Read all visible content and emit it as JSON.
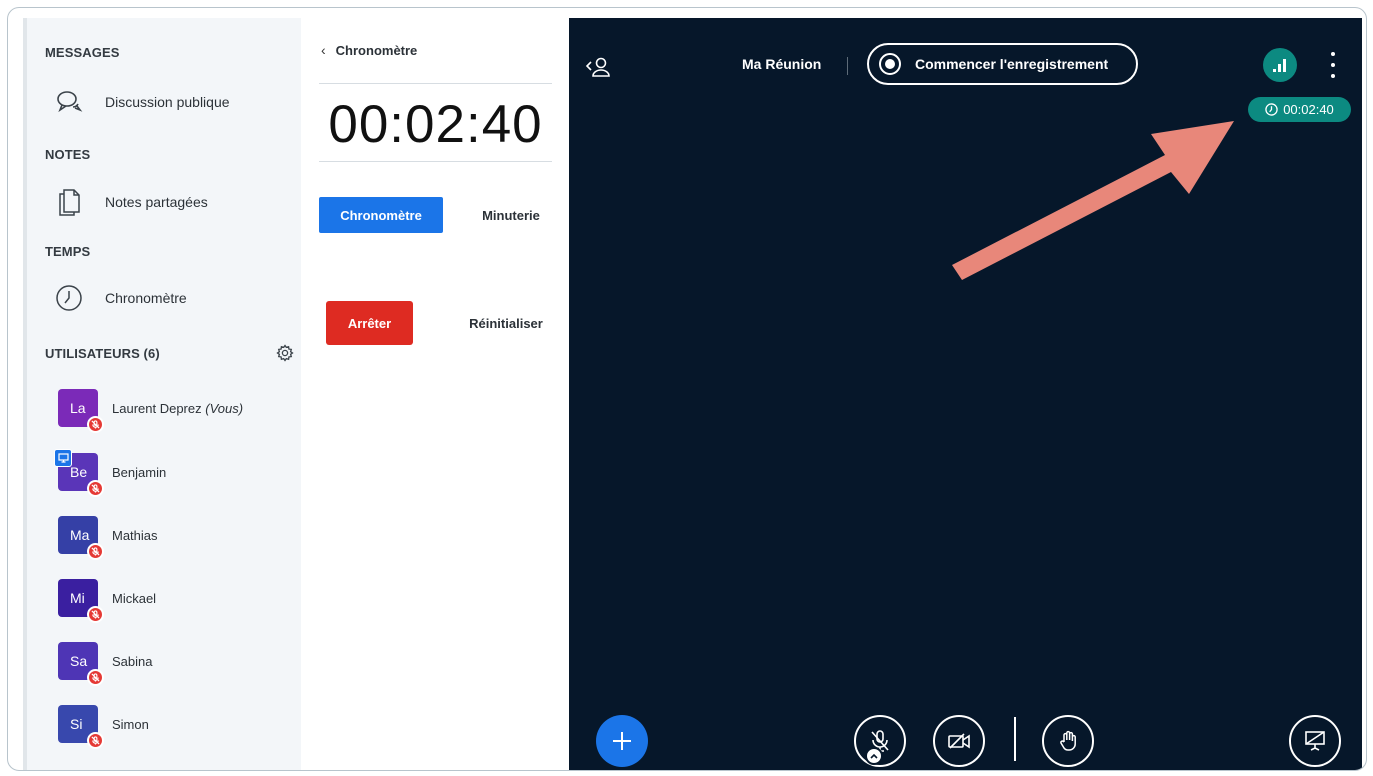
{
  "sidebar": {
    "messages_title": "MESSAGES",
    "public_chat_label": "Discussion publique",
    "notes_title": "NOTES",
    "shared_notes_label": "Notes partagées",
    "time_title": "TEMPS",
    "stopwatch_label": "Chronomètre",
    "users_title": "UTILISATEURS (6)",
    "users": [
      {
        "initials": "La",
        "name": "Laurent Deprez",
        "suffix": "(Vous)",
        "color": "#7b2ab8"
      },
      {
        "initials": "Be",
        "name": "Benjamin",
        "suffix": "",
        "color": "#5a35b8"
      },
      {
        "initials": "Ma",
        "name": "Mathias",
        "suffix": "",
        "color": "#3540a6"
      },
      {
        "initials": "Mi",
        "name": "Mickael",
        "suffix": "",
        "color": "#3a1fa0"
      },
      {
        "initials": "Sa",
        "name": "Sabina",
        "suffix": "",
        "color": "#4e35b5"
      },
      {
        "initials": "Si",
        "name": "Simon",
        "suffix": "",
        "color": "#3848ad"
      }
    ]
  },
  "timer_panel": {
    "title": "Chronomètre",
    "time": "00:02:40",
    "tab_stopwatch": "Chronomètre",
    "tab_timer": "Minuterie",
    "stop_label": "Arrêter",
    "reset_label": "Réinitialiser"
  },
  "stage": {
    "meeting_name": "Ma Réunion",
    "record_label": "Commencer l'enregistrement",
    "timer_badge": "00:02:40"
  },
  "colors": {
    "primary_blue": "#1b75e8",
    "stop_red": "#de2b22",
    "teal": "#0c8a81",
    "stage_bg": "#06172a",
    "arrow": "#e8877a"
  },
  "icons": [
    "chat-icon",
    "notes-icon",
    "clock-icon",
    "gear-icon",
    "user-toggle-icon",
    "signal-icon",
    "more-icon",
    "plus-icon",
    "mic-muted-icon",
    "camera-off-icon",
    "hand-icon",
    "presentation-icon"
  ]
}
